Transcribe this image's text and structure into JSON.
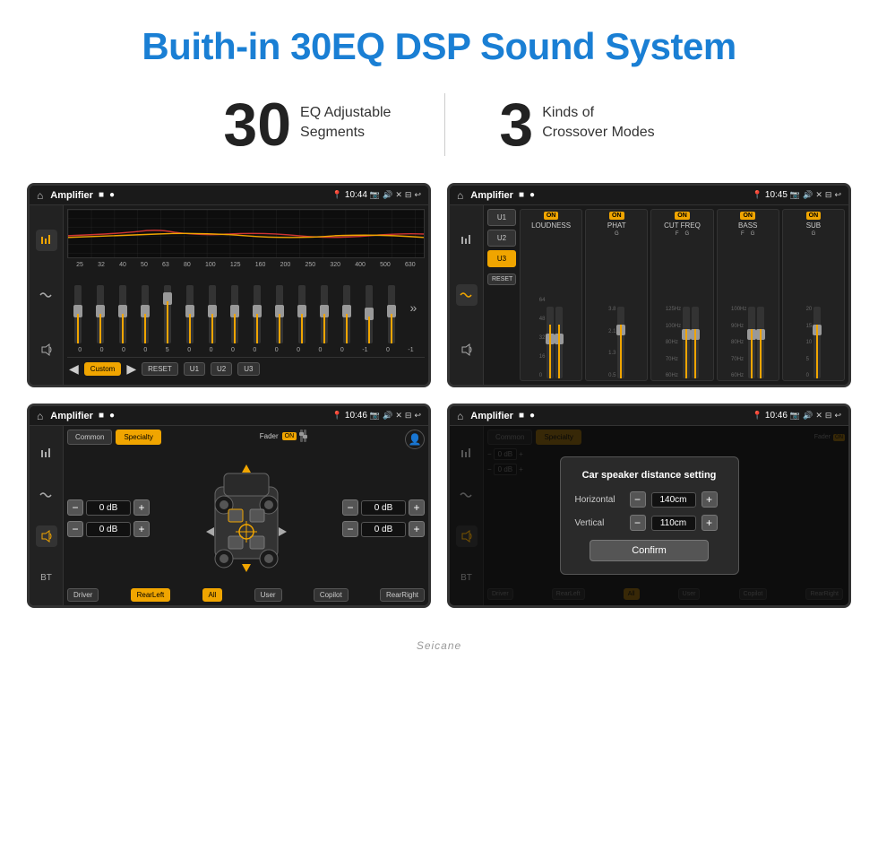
{
  "page": {
    "title": "Buith-in 30EQ DSP Sound System",
    "stat1_number": "30",
    "stat1_desc_line1": "EQ Adjustable",
    "stat1_desc_line2": "Segments",
    "stat2_number": "3",
    "stat2_desc_line1": "Kinds of",
    "stat2_desc_line2": "Crossover Modes"
  },
  "screens": {
    "eq_title": "Amplifier",
    "eq_time": "10:44",
    "eq_freq_labels": [
      "25",
      "32",
      "40",
      "50",
      "63",
      "80",
      "100",
      "125",
      "160",
      "200",
      "250",
      "320",
      "400",
      "500",
      "630"
    ],
    "eq_values": [
      "0",
      "0",
      "0",
      "0",
      "5",
      "0",
      "0",
      "0",
      "0",
      "0",
      "0",
      "0",
      "0",
      "-1",
      "0",
      "-1"
    ],
    "eq_custom": "Custom",
    "eq_reset": "RESET",
    "eq_u1": "U1",
    "eq_u2": "U2",
    "eq_u3": "U3",
    "crossover_title": "Amplifier",
    "crossover_time": "10:45",
    "crossover_u1": "U1",
    "crossover_u2": "U2",
    "crossover_u3": "U3",
    "crossover_channels": [
      "LOUDNESS",
      "PHAT",
      "CUT FREQ",
      "BASS",
      "SUB"
    ],
    "crossover_reset": "RESET",
    "specialty_title": "Amplifier",
    "specialty_time": "10:46",
    "specialty_common": "Common",
    "specialty_specialty": "Specialty",
    "specialty_fader": "Fader",
    "specialty_on": "ON",
    "specialty_driver": "Driver",
    "specialty_rearLeft": "RearLeft",
    "specialty_all": "All",
    "specialty_user": "User",
    "specialty_copilot": "Copilot",
    "specialty_rearRight": "RearRight",
    "specialty_0db1": "0 dB",
    "specialty_0db2": "0 dB",
    "specialty_0db3": "0 dB",
    "specialty_0db4": "0 dB",
    "dialog_title": "Car speaker distance setting",
    "dialog_horizontal_label": "Horizontal",
    "dialog_horizontal_value": "140cm",
    "dialog_vertical_label": "Vertical",
    "dialog_vertical_value": "110cm",
    "dialog_confirm": "Confirm",
    "branding": "Seicane"
  },
  "icons": {
    "home": "⌂",
    "menu": "≡",
    "record": "●",
    "location": "📍",
    "camera": "📷",
    "volume": "🔊",
    "close": "✕",
    "window": "⊟",
    "back": "↩",
    "play": "▶",
    "prev": "◀",
    "more": "»",
    "eq_icon": "🎛",
    "wave_icon": "〜",
    "speaker_icon": "🔈",
    "bluetooth": "⚡",
    "settings": "⚙",
    "person": "👤"
  }
}
